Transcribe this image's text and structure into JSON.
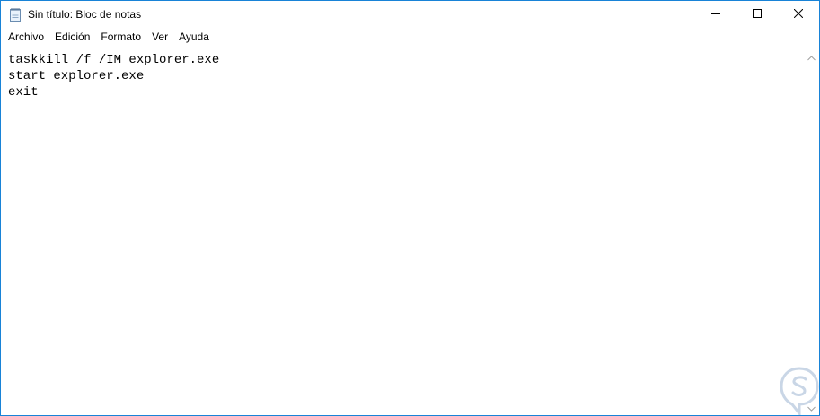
{
  "window": {
    "title": "Sin título: Bloc de notas",
    "accent_color": "#1883d7",
    "icons": {
      "app": "notepad-icon",
      "minimize": "minimize-icon",
      "maximize": "maximize-icon",
      "close": "close-icon"
    }
  },
  "menu": {
    "items": [
      "Archivo",
      "Edición",
      "Formato",
      "Ver",
      "Ayuda"
    ]
  },
  "editor": {
    "content": "taskkill /f /IM explorer.exe\nstart explorer.exe\nexit"
  },
  "scrollbar": {
    "up_icon": "chevron-up-icon",
    "down_icon": "chevron-down-icon"
  },
  "watermark": {
    "logo": "s-logo",
    "color": "#c9d6e6"
  }
}
